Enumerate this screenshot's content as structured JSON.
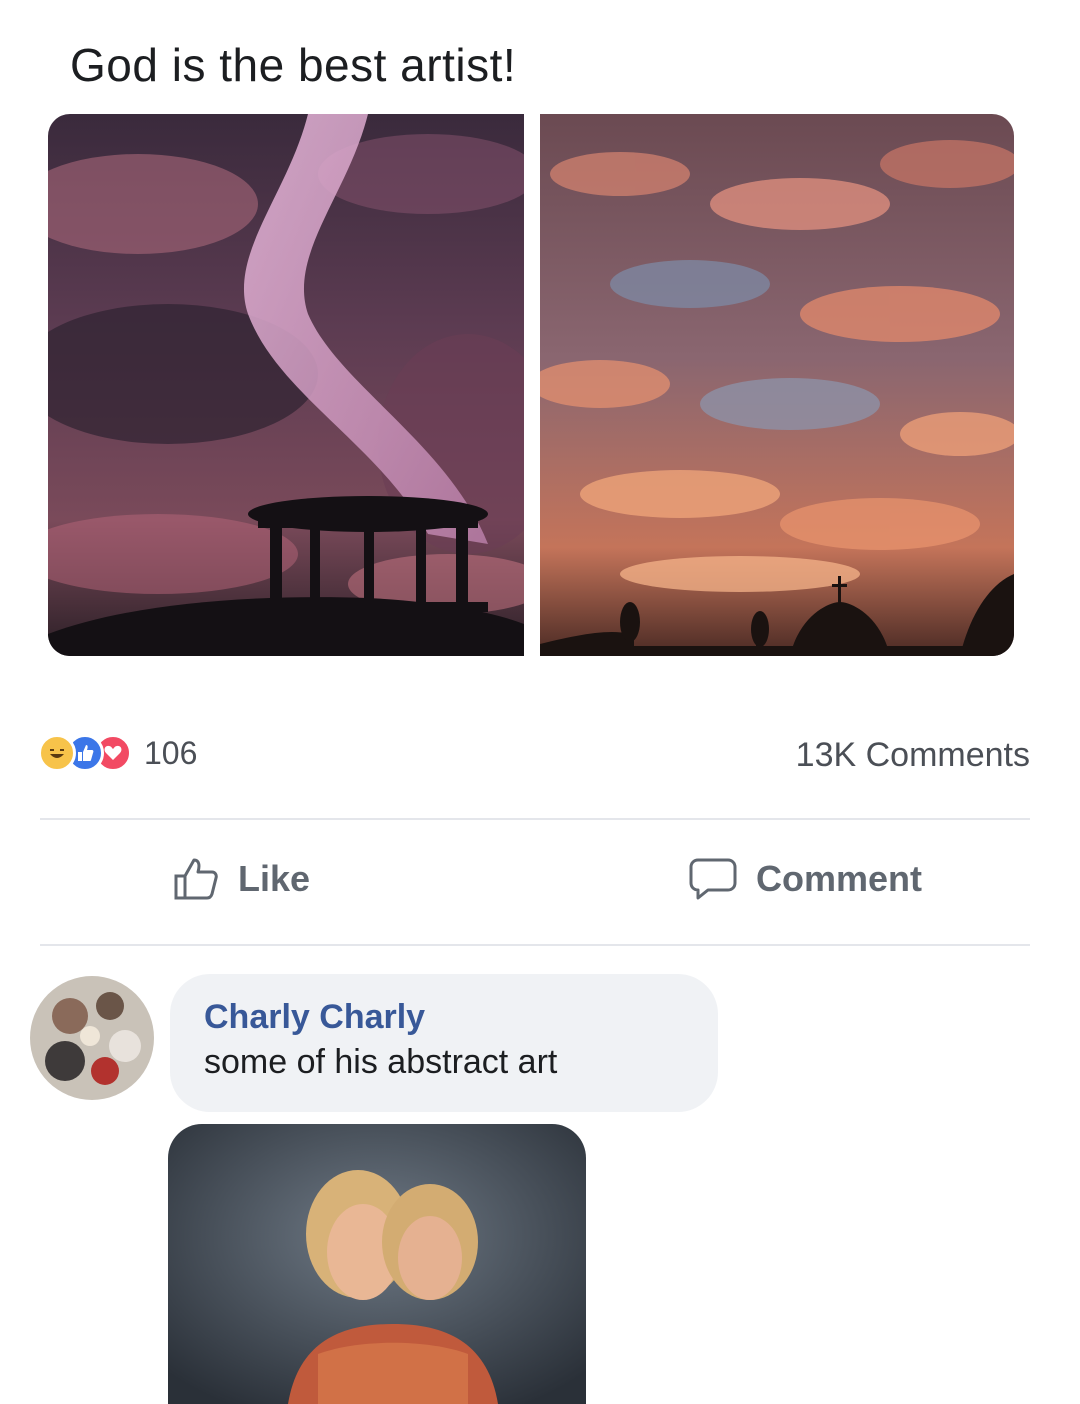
{
  "post": {
    "text": "God is the best artist!"
  },
  "photos": {
    "left_icon": "sunset-sky-gazebo-photo",
    "right_icon": "sunset-sky-clouds-photo"
  },
  "reactions": {
    "icons": [
      "haha-reaction-icon",
      "like-reaction-icon",
      "love-reaction-icon"
    ],
    "count": "106",
    "comments_count": "13K Comments"
  },
  "actions": {
    "like_label": "Like",
    "comment_label": "Comment"
  },
  "comment": {
    "author": "Charly Charly",
    "text": "some of his abstract art",
    "photo_icon": "portrait-photo"
  },
  "colors": {
    "like_blue": "#3b76e8",
    "love_red": "#f24a63",
    "haha_yellow": "#f7c34a",
    "name_blue": "#385898",
    "bubble_gray": "#f0f2f5"
  }
}
